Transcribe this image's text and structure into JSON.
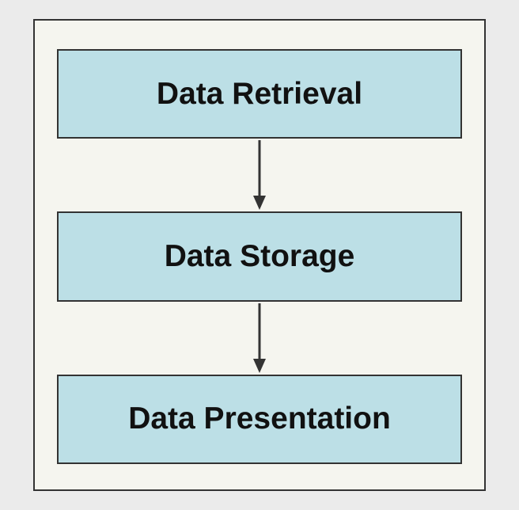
{
  "diagram": {
    "boxes": [
      {
        "label": "Data Retrieval"
      },
      {
        "label": "Data Storage"
      },
      {
        "label": "Data Presentation"
      }
    ]
  }
}
